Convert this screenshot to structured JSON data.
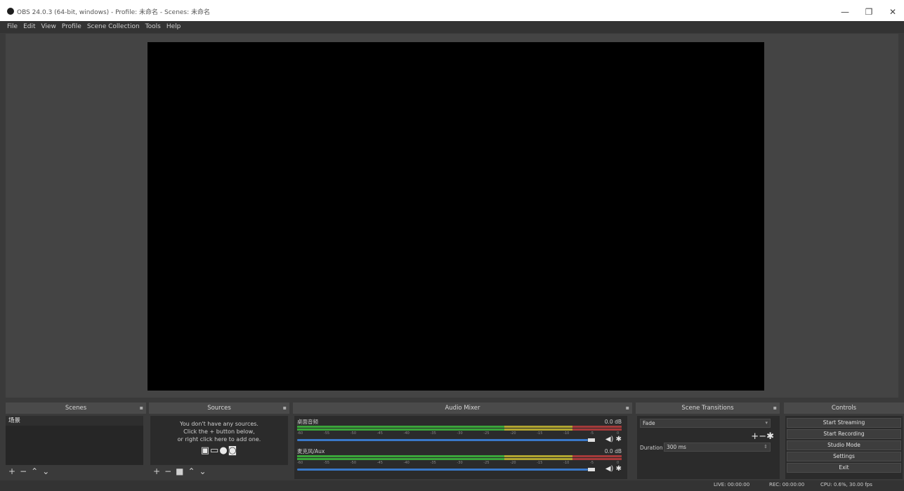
{
  "window": {
    "title": "OBS 24.0.3 (64-bit, windows) - Profile: 未命名 - Scenes: 未命名",
    "minimize": "—",
    "maximize": "❐",
    "close": "✕"
  },
  "menu": [
    "File",
    "Edit",
    "View",
    "Profile",
    "Scene Collection",
    "Tools",
    "Help"
  ],
  "docks": {
    "scenes": {
      "title": "Scenes",
      "items": [
        "场景"
      ]
    },
    "sources": {
      "title": "Sources",
      "empty_line1": "You don't have any sources.",
      "empty_line2": "Click the + button below,",
      "empty_line3": "or right click here to add one.",
      "icons": [
        "image-icon",
        "display-icon",
        "globe-icon",
        "camera-icon"
      ]
    },
    "mixer": {
      "title": "Audio Mixer",
      "tracks": [
        {
          "name": "桌面音频",
          "db": "0.0 dB"
        },
        {
          "name": "麦克风/Aux",
          "db": "0.0 dB"
        }
      ],
      "tick_labels": [
        "-60",
        "-55",
        "-50",
        "-45",
        "-40",
        "-35",
        "-30",
        "-25",
        "-20",
        "-15",
        "-10",
        "-5",
        "0"
      ]
    },
    "transitions": {
      "title": "Scene Transitions",
      "selected": "Fade",
      "duration_label": "Duration",
      "duration_value": "300 ms"
    },
    "controls": {
      "title": "Controls",
      "buttons": [
        "Start Streaming",
        "Start Recording",
        "Studio Mode",
        "Settings",
        "Exit"
      ]
    }
  },
  "status": {
    "live": "LIVE: 00:00:00",
    "rec": "REC: 00:00:00",
    "cpu": "CPU: 0.6%, 30.00 fps"
  },
  "colors": {
    "background": "#3a3a3a",
    "preview": "#000000",
    "meter_green": "#3aa53a",
    "meter_yellow": "#b0a530",
    "meter_red": "#a53a3a",
    "volume_blue": "#3a78c8"
  }
}
